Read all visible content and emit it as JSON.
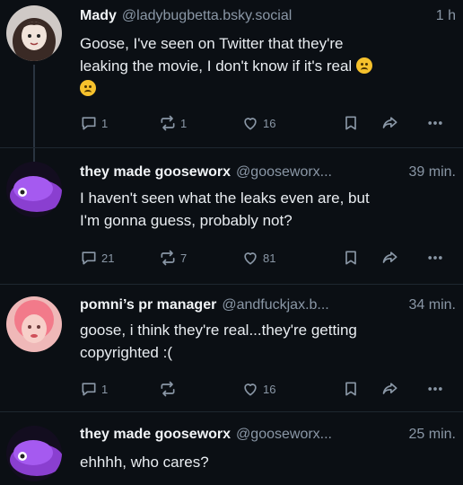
{
  "posts": [
    {
      "name": "Mady",
      "handle": "@ladybugbetta.bsky.social",
      "time": "1 h",
      "text_line1": "Goose, I've seen on Twitter that they're",
      "text_line2": "leaking the movie, I don't know if it's real",
      "replies": "1",
      "reposts": "1",
      "likes": "16"
    },
    {
      "name": "they made gooseworx",
      "handle": "@gooseworx...",
      "time": "39 min.",
      "text_line1": "I haven't seen what the leaks even are, but",
      "text_line2": "I'm gonna guess, probably not?",
      "replies": "21",
      "reposts": "7",
      "likes": "81"
    },
    {
      "name": "pomni’s pr manager",
      "handle": "@andfuckjax.b...",
      "time": "34 min.",
      "text_line1": "goose, i think they're real...they're getting",
      "text_line2": "copyrighted :(",
      "replies": "1",
      "reposts": "",
      "likes": "16"
    },
    {
      "name": "they made gooseworx",
      "handle": "@gooseworx...",
      "time": "25 min.",
      "text_line1": "ehhhh, who cares?"
    }
  ],
  "colors": {
    "background": "#0b0f14",
    "muted": "#8a97a6",
    "thread_line": "#2a3440"
  },
  "icons": [
    "reply-icon",
    "repost-icon",
    "like-icon",
    "bookmark-icon",
    "share-icon",
    "more-icon"
  ]
}
